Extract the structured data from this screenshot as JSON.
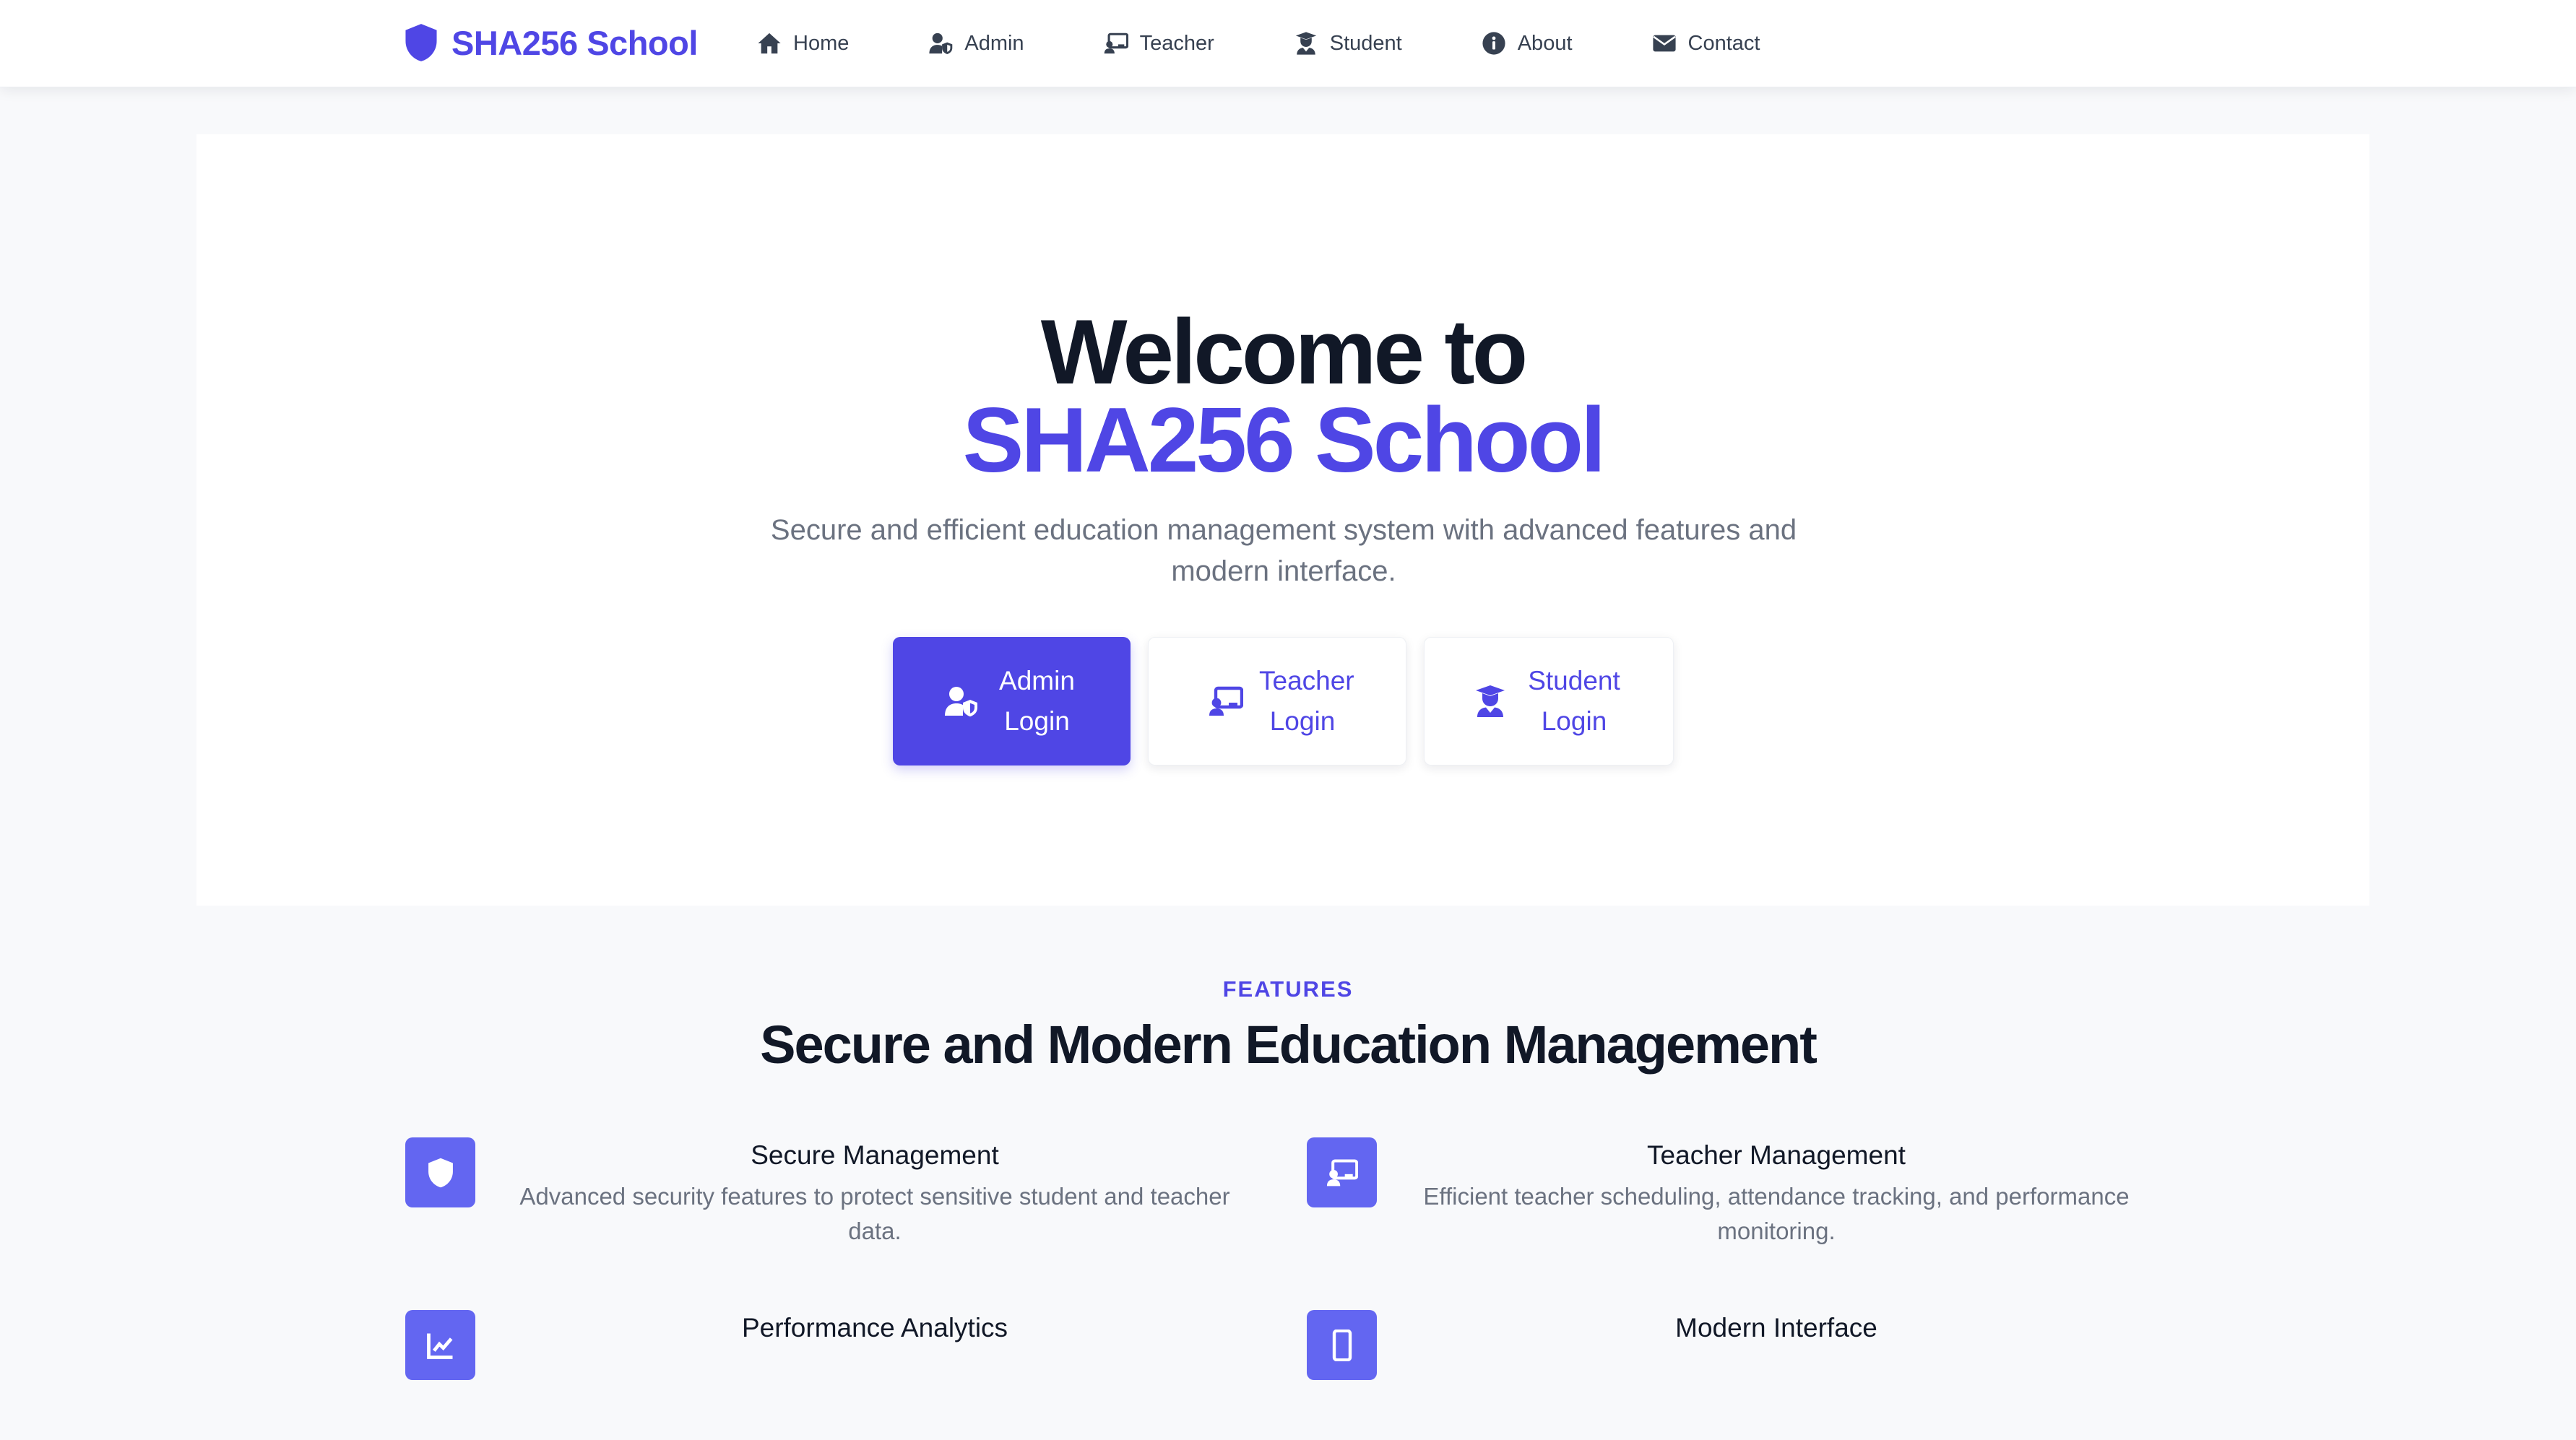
{
  "nav": {
    "brand": "SHA256 School",
    "items": [
      {
        "label": "Home",
        "icon": "home-icon"
      },
      {
        "label": "Admin",
        "icon": "user-shield-icon"
      },
      {
        "label": "Teacher",
        "icon": "chalkboard-teacher-icon"
      },
      {
        "label": "Student",
        "icon": "user-graduate-icon"
      },
      {
        "label": "About",
        "icon": "info-circle-icon"
      },
      {
        "label": "Contact",
        "icon": "envelope-icon"
      }
    ]
  },
  "hero": {
    "title_line1": "Welcome to",
    "title_line2": "SHA256 School",
    "subtitle": "Secure and efficient education management system with advanced features and modern interface.",
    "buttons": [
      {
        "label": "Admin Login",
        "icon": "user-shield-icon",
        "style": "primary"
      },
      {
        "label": "Teacher Login",
        "icon": "chalkboard-teacher-icon",
        "style": "secondary"
      },
      {
        "label": "Student Login",
        "icon": "user-graduate-icon",
        "style": "secondary"
      }
    ]
  },
  "features": {
    "eyebrow": "FEATURES",
    "title": "Secure and Modern Education Management",
    "items": [
      {
        "title": "Secure Management",
        "description": "Advanced security features to protect sensitive student and teacher data.",
        "icon": "shield-icon"
      },
      {
        "title": "Teacher Management",
        "description": "Efficient teacher scheduling, attendance tracking, and performance monitoring.",
        "icon": "chalkboard-teacher-icon"
      },
      {
        "title": "Performance Analytics",
        "description": "",
        "icon": "chart-line-icon"
      },
      {
        "title": "Modern Interface",
        "description": "",
        "icon": "mobile-icon"
      }
    ]
  },
  "colors": {
    "brand": "#4f46e5",
    "feature_icon_bg": "#6366f1",
    "heading": "#111827",
    "muted": "#6b7280",
    "page_bg": "#f8f9fb"
  }
}
